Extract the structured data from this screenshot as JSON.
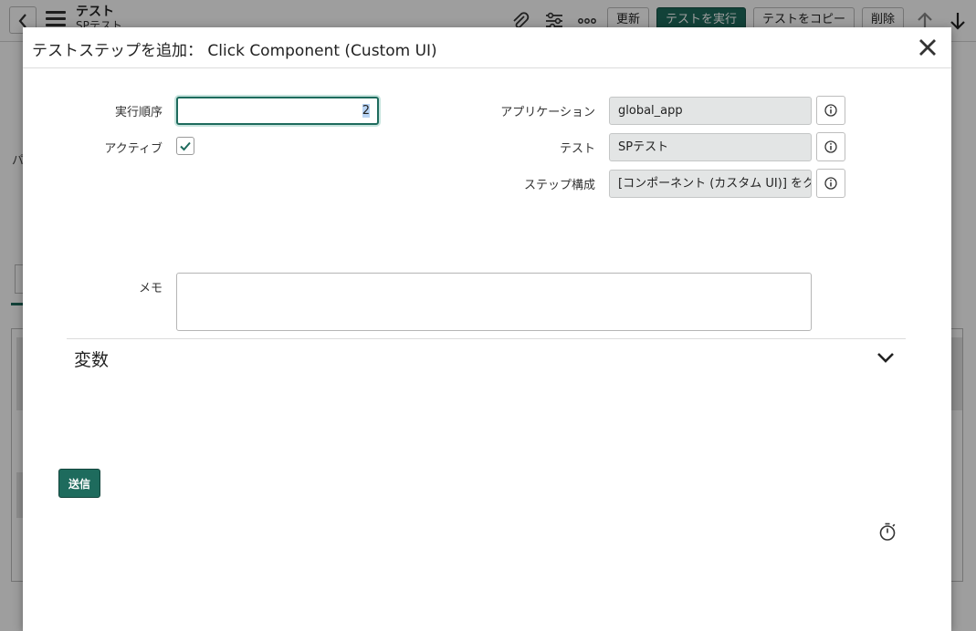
{
  "app_header": {
    "title": "テスト",
    "subtitle": "SPテスト",
    "buttons": {
      "update": "更新",
      "run_test": "テストを実行",
      "copy_test": "テストをコピー",
      "delete": "削除"
    },
    "icons": [
      "back-icon",
      "menu-icon",
      "attachment-icon",
      "settings-sliders-icon",
      "more-options-icon",
      "up-arrow-icon",
      "down-arrow-icon"
    ]
  },
  "background": {
    "side_letter": "パ"
  },
  "modal": {
    "title": "テストステップを追加： Click Component (Custom UI)",
    "close_icon": "close-icon",
    "form": {
      "execution_order": {
        "label": "実行順序",
        "value": "2"
      },
      "active": {
        "label": "アクティブ",
        "checked": true
      },
      "application": {
        "label": "アプリケーション",
        "value": "global_app"
      },
      "test": {
        "label": "テスト",
        "value": "SPテスト"
      },
      "step_config": {
        "label": "ステップ構成",
        "value": "[コンポーネント (カスタム UI)] をク"
      },
      "memo": {
        "label": "メモ",
        "value": ""
      }
    },
    "variables_section": {
      "label": "変数",
      "expanded": false
    },
    "submit_label": "送信"
  },
  "colors": {
    "accent": "#1e6b5d",
    "readonly_field": "#e3e5e5",
    "overlay": "rgba(0,0,0,0.38)"
  }
}
